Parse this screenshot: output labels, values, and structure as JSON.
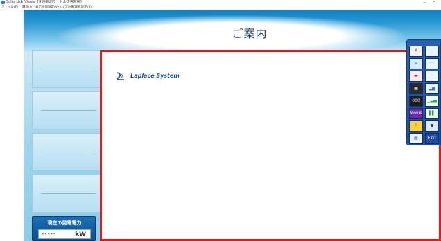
{
  "window": {
    "title": "Solar Link Viewer [化内観測モードル送信監視]",
    "minimize": "–",
    "restore": "▫"
  },
  "menu": {
    "items": [
      "ファイル(F)",
      "履歴(I)",
      "表示画面設定(V)",
      "ヘルプ(H)",
      "管理者設定(S)"
    ]
  },
  "header": {
    "title": "ご案内"
  },
  "left_nav": {
    "panels": 4
  },
  "power": {
    "label": "現在の発電電力",
    "value": "-----",
    "unit": "kW"
  },
  "content": {
    "logo_text": "Laplace System"
  },
  "toolbar": {
    "buttons": [
      {
        "name": "text-tool",
        "glyph": "A",
        "bg": "#f3f3f3",
        "fg": "#cc2222"
      },
      {
        "name": "line-tool",
        "glyph": "—",
        "bg": "#e9f4ff",
        "fg": "#1d4d9b"
      },
      {
        "name": "list-tool",
        "glyph": "≡",
        "bg": "#d8ecff",
        "fg": "#1f6fbf"
      },
      {
        "name": "banner-tool",
        "glyph": "▭",
        "bg": "#eaf6ff",
        "fg": "#38a0e0"
      },
      {
        "name": "gradient-tool",
        "glyph": "▬",
        "bg": "#ffe7ec",
        "fg": "#d03050"
      },
      {
        "name": "dots-tool",
        "glyph": "···",
        "bg": "#eef6ff",
        "fg": "#2b73c7"
      },
      {
        "name": "meter-tool",
        "glyph": "▦",
        "bg": "#2b2b2b",
        "fg": "#ffffff"
      },
      {
        "name": "bar-tool",
        "glyph": "▂▅",
        "bg": "#e6f3ff",
        "fg": "#2f7fd0"
      },
      {
        "name": "counter-tool",
        "glyph": "000",
        "bg": "#1c1c1c",
        "fg": "#e8e8e8"
      },
      {
        "name": "chart-tool",
        "glyph": "▁▃▅",
        "bg": "#f2fff2",
        "fg": "#2aa84a"
      },
      {
        "name": "movie-tool",
        "glyph": "Movie",
        "bg": "#6a2ca0",
        "fg": "#ffffff"
      },
      {
        "name": "graph-tool",
        "glyph": "▌▌",
        "bg": "#e9ffe9",
        "fg": "#1f9a3a"
      },
      {
        "name": "alert-tool",
        "glyph": "!",
        "bg": "#ffd23a",
        "fg": "#7a3b00"
      },
      {
        "name": "cup-tool",
        "glyph": "▮",
        "bg": "#dfe8f7",
        "fg": "#1d3f7a"
      },
      {
        "name": "table-tool",
        "glyph": "▤",
        "bg": "#e8f4ff",
        "fg": "#1d4d9b"
      },
      {
        "name": "exit-tool",
        "glyph": "EXIT",
        "bg": "#1d4d9b",
        "fg": "#ffffff"
      }
    ]
  },
  "colors": {
    "frame_red": "#e01818",
    "brand_blue": "#1f4a8a",
    "header_blue": "#0f7fc0"
  }
}
